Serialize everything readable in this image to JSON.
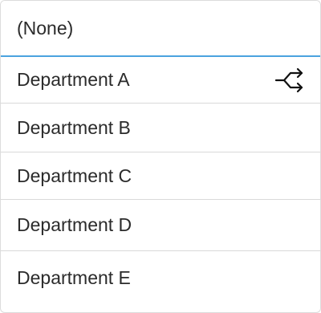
{
  "dropdown": {
    "options": [
      {
        "label": "(None)",
        "selected": true
      },
      {
        "label": "Department A",
        "icon": "branch-split-icon"
      },
      {
        "label": "Department B"
      },
      {
        "label": "Department C"
      },
      {
        "label": "Department D"
      },
      {
        "label": "Department E"
      }
    ],
    "accent_color": "#4aa3df"
  }
}
